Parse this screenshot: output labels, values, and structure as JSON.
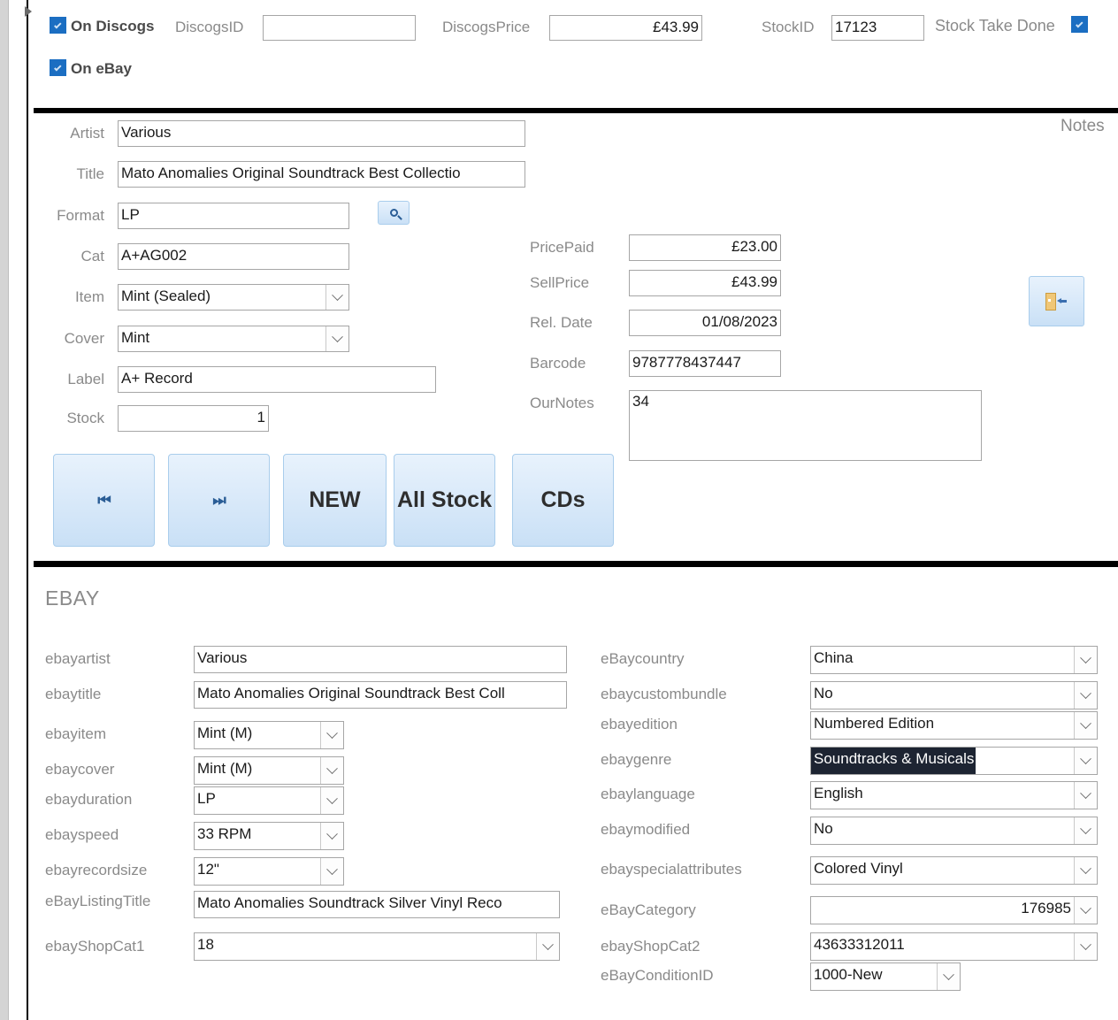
{
  "window": {
    "record_selector_icon": "triangle-right-icon"
  },
  "header": {
    "on_discogs_label": "On Discogs",
    "on_discogs_checked": true,
    "discogs_id_label": "DiscogsID",
    "discogs_id_value": "",
    "discogs_price_label": "DiscogsPrice",
    "discogs_price_value": "£43.99",
    "stock_id_label": "StockID",
    "stock_id_value": "17123",
    "stock_take_done_label": "Stock Take Done",
    "stock_take_done_checked": true,
    "on_ebay_label": "On eBay",
    "on_ebay_checked": true
  },
  "details": {
    "notes_label": "Notes",
    "artist_label": "Artist",
    "artist_value": "Various",
    "title_label": "Title",
    "title_value": "Mato Anomalies Original Soundtrack Best Collectio",
    "format_label": "Format",
    "format_value": "LP",
    "format_search_icon": "magnifier-icon",
    "cat_label": "Cat",
    "cat_value": "A+AG002",
    "item_label": "Item",
    "item_value": "Mint (Sealed)",
    "cover_label": "Cover",
    "cover_value": "Mint",
    "label_label": "Label",
    "label_value": "A+ Record",
    "stock_label": "Stock",
    "stock_value": "1",
    "price_paid_label": "PricePaid",
    "price_paid_value": "£23.00",
    "sell_price_label": "SellPrice",
    "sell_price_value": "£43.99",
    "rel_date_label": "Rel. Date",
    "rel_date_value": "01/08/2023",
    "barcode_label": "Barcode",
    "barcode_value": "9787778437447",
    "our_notes_label": "OurNotes",
    "our_notes_value": "34",
    "exit_icon": "door-exit-icon"
  },
  "toolbar": {
    "first_record_label": "⏮",
    "first_record_icon": "skip-to-first-icon",
    "last_record_label": "⏭",
    "last_record_icon": "skip-to-last-icon",
    "new_label": "NEW",
    "all_stock_label": "All Stock",
    "cds_label": "CDs"
  },
  "ebay": {
    "section_title": "EBAY",
    "left_fields": [
      {
        "label": "ebayartist",
        "value": "Various",
        "type": "text"
      },
      {
        "label": "ebaytitle",
        "value": "Mato Anomalies Original Soundtrack Best Coll",
        "type": "text"
      },
      {
        "label": "ebayitem",
        "value": "Mint (M)",
        "type": "combo"
      },
      {
        "label": "ebaycover",
        "value": "Mint (M)",
        "type": "combo"
      },
      {
        "label": "ebayduration",
        "value": "LP",
        "type": "combo"
      },
      {
        "label": "ebayspeed",
        "value": "33 RPM",
        "type": "combo"
      },
      {
        "label": "ebayrecordsize",
        "value": "12\"",
        "type": "combo"
      },
      {
        "label": "eBayListingTitle",
        "value": "Mato Anomalies Soundtrack Silver Vinyl Reco",
        "type": "text"
      },
      {
        "label": "ebayShopCat1",
        "value": "18",
        "type": "combo"
      }
    ],
    "right_fields": [
      {
        "label": "eBaycountry",
        "value": "China",
        "type": "combo"
      },
      {
        "label": "ebaycustombundle",
        "value": "No",
        "type": "combo"
      },
      {
        "label": "ebayedition",
        "value": "Numbered Edition",
        "type": "combo"
      },
      {
        "label": "ebaygenre",
        "value": "Soundtracks & Musicals",
        "type": "combo",
        "selected": true
      },
      {
        "label": "ebaylanguage",
        "value": "English",
        "type": "combo"
      },
      {
        "label": "ebaymodified",
        "value": "No",
        "type": "combo"
      },
      {
        "label": "ebayspecialattributes",
        "value": "Colored Vinyl",
        "type": "combo"
      },
      {
        "label": "eBayCategory",
        "value": "176985",
        "type": "combo",
        "align": "right"
      },
      {
        "label": "ebayShopCat2",
        "value": "43633312011",
        "type": "combo"
      },
      {
        "label": "eBayConditionID",
        "value": "1000-New",
        "type": "combo"
      }
    ]
  },
  "colors": {
    "accent_blue": "#1b6ec2",
    "label_gray": "#8a8a8a",
    "selection_dark": "#1d2432",
    "button_blue": "#c9e0f6"
  }
}
